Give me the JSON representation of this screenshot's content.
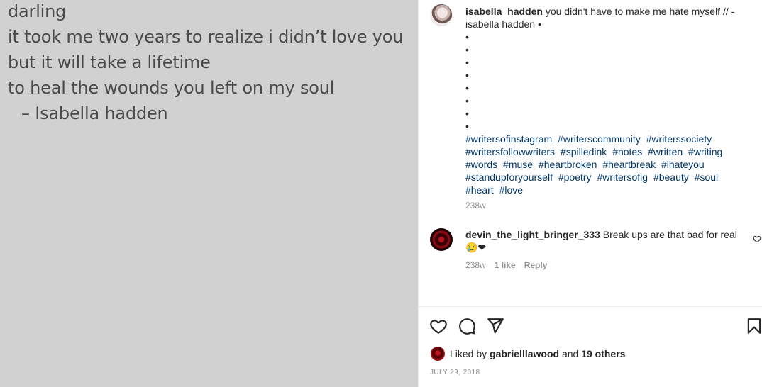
{
  "poem": {
    "lines": [
      "darling",
      "it took me two years to realize i didn’t love you",
      "but it will take a lifetime",
      "to heal the wounds you left on my soul"
    ],
    "signature": "–   Isabella hadden"
  },
  "caption": {
    "username": "isabella_hadden",
    "text": "you didn't have to make me hate myself // - isabella hadden •",
    "bullets": [
      "•",
      "•",
      "•",
      "•",
      "•",
      "•",
      "•",
      "•"
    ],
    "hashtags": [
      "#writersofinstagram",
      "#writerscommunity",
      "#writerssociety",
      "#writersfollowwriters",
      "#spilledink",
      "#notes",
      "#written",
      "#writing",
      "#words",
      "#muse",
      "#heartbroken",
      "#heartbreak",
      "#ihateyou",
      "#standupforyourself",
      "#poetry",
      "#writersofig",
      "#beauty",
      "#soul",
      "#heart",
      "#love"
    ],
    "time": "238w"
  },
  "comment": {
    "username": "devin_the_light_bringer_333",
    "text": "Break ups are that bad for real 😢❤",
    "time": "238w",
    "likes": "1 like",
    "reply": "Reply"
  },
  "actions": {
    "like_icon": "heart-outline-icon",
    "comment_icon": "speech-bubble-icon",
    "share_icon": "paper-plane-icon",
    "save_icon": "bookmark-icon"
  },
  "likes": {
    "prefix": "Liked by",
    "user": "gabrielllawood",
    "conjunction": "and",
    "others": "19 others"
  },
  "post_date": "JULY 29, 2018",
  "colors": {
    "image_background": "#d1d1d1",
    "hashtag": "#00376b",
    "muted": "#8e8e8e"
  }
}
